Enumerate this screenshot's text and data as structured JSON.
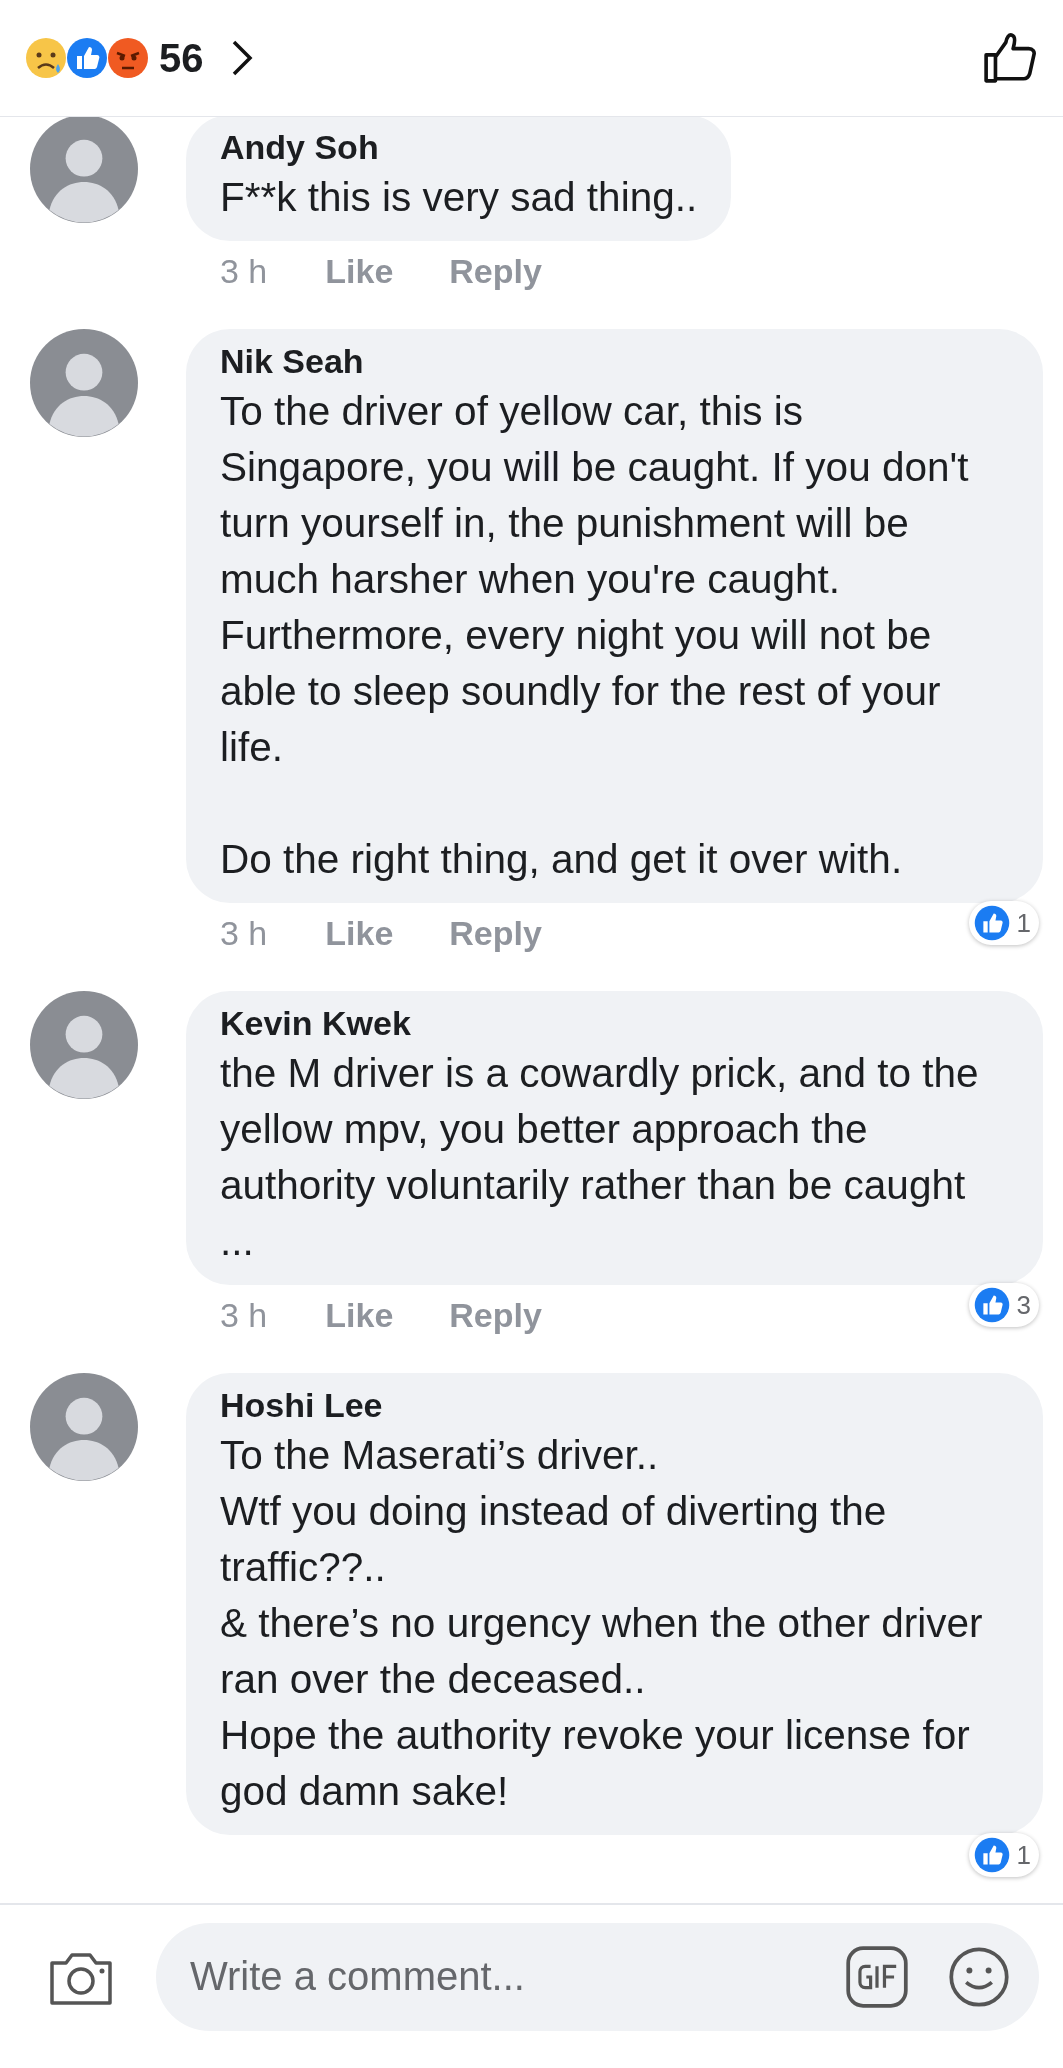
{
  "header": {
    "reaction_count": "56"
  },
  "comments": [
    {
      "author": "Andy Soh",
      "text": "F**k this is very sad thing..",
      "time": "3 h",
      "like": "Like",
      "reply": "Reply"
    },
    {
      "author": "Nik Seah",
      "text": "To the driver of yellow car, this is Singapore, you will be caught. If you don't turn yourself in, the punishment will be much harsher when you're caught. Furthermore, every night you will not be able to sleep soundly for the rest of your life.\n\nDo the right thing, and get it over with.",
      "time": "3 h",
      "like": "Like",
      "reply": "Reply",
      "reactions": "1"
    },
    {
      "author": "Kevin Kwek",
      "text": "the M driver is a cowardly prick, and to the yellow mpv, you better approach the authority voluntarily rather than be caught ...",
      "time": "3 h",
      "like": "Like",
      "reply": "Reply",
      "reactions": "3"
    },
    {
      "author": "Hoshi Lee",
      "text": "To the Maserati’s driver..\nWtf you doing instead of diverting the traffic??..\n& there’s no urgency when the other driver ran over the deceased..\nHope the authority revoke your license for god damn sake!",
      "reactions": "1"
    }
  ],
  "composer": {
    "placeholder": "Write a comment..."
  }
}
